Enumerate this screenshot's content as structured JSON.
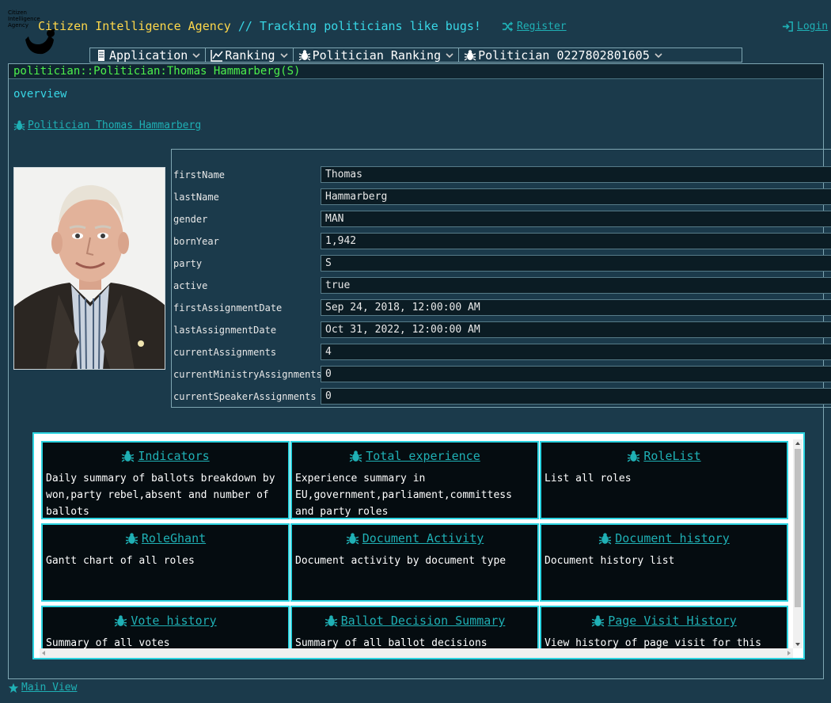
{
  "header": {
    "logo_text": "Citizen Intelligence Agency",
    "title": "Citizen Intelligence Agency",
    "tagline": " // Tracking politicians like bugs!",
    "register": "Register",
    "login": "Login"
  },
  "menu": [
    {
      "label": "Application",
      "icon": "document-icon"
    },
    {
      "label": "Ranking",
      "icon": "line-chart-icon"
    },
    {
      "label": "Politician Ranking",
      "icon": "bug-icon"
    },
    {
      "label": "Politician 0227802801605",
      "icon": "bug-icon"
    }
  ],
  "panel": {
    "caption": "politician::Politician:Thomas Hammarberg(S)",
    "overview": "overview",
    "politician_link": "Politician Thomas Hammarberg"
  },
  "fields": [
    {
      "label": "firstName",
      "value": "Thomas"
    },
    {
      "label": "lastName",
      "value": "Hammarberg"
    },
    {
      "label": "gender",
      "value": "MAN"
    },
    {
      "label": "bornYear",
      "value": "1,942"
    },
    {
      "label": "party",
      "value": "S"
    },
    {
      "label": "active",
      "value": "true"
    },
    {
      "label": "firstAssignmentDate",
      "value": "Sep 24, 2018, 12:00:00 AM"
    },
    {
      "label": "lastAssignmentDate",
      "value": "Oct 31, 2022, 12:00:00 AM"
    },
    {
      "label": "currentAssignments",
      "value": "4"
    },
    {
      "label": "currentMinistryAssignments",
      "value": "0"
    },
    {
      "label": "currentSpeakerAssignments",
      "value": "0"
    }
  ],
  "cards": [
    {
      "title": "Indicators",
      "desc": "Daily summary of ballots breakdown by won,party rebel,absent and number of ballots"
    },
    {
      "title": "Total experience",
      "desc": "Experience summary in EU,government,parliament,committess and party roles"
    },
    {
      "title": "RoleList",
      "desc": "List all roles"
    },
    {
      "title": "RoleGhant",
      "desc": "Gantt chart of all roles"
    },
    {
      "title": "Document Activity",
      "desc": "Document activity by document type"
    },
    {
      "title": "Document history",
      "desc": "Document history list"
    },
    {
      "title": "Vote history",
      "desc": "Summary of all votes"
    },
    {
      "title": "Ballot Decision Summary",
      "desc": "Summary of all ballot decisions"
    },
    {
      "title": "Page Visit History",
      "desc": "View history of page visit for this page."
    }
  ],
  "footer": {
    "main_view": "Main View"
  },
  "colors": {
    "background": "#1b3a4b",
    "accent": "#2bd3e0",
    "title_yellow": "#ffd84a",
    "caption_green": "#4cf04c",
    "link": "#1fb0b5"
  }
}
